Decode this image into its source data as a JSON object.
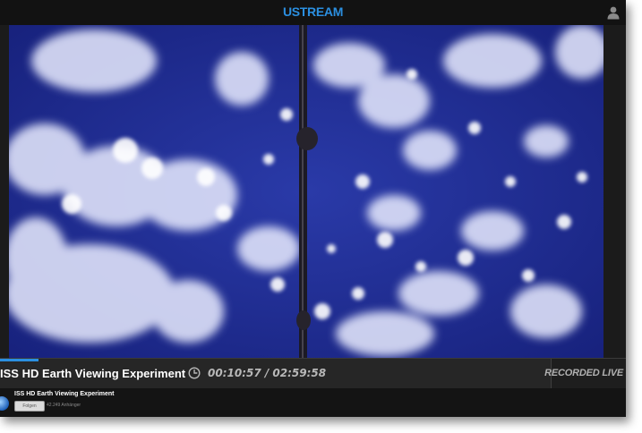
{
  "header": {
    "logo_text": "USTREAM",
    "logo_color": "#2b8fe0",
    "user_icon": "user-icon"
  },
  "video": {
    "description_icon": "earth-video-frame"
  },
  "player_bar": {
    "title": "ISS HD Earth Viewing Experiment",
    "clock_icon": "clock-icon",
    "time": "00:10:57 / 02:59:58",
    "progress_fraction": 0.061,
    "recorded_label": "RECORDED LIVE"
  },
  "channel": {
    "name": "ISS HD Earth Viewing Experiment",
    "follow_label": "Folgen",
    "followers": "42.249 Anhänger"
  }
}
